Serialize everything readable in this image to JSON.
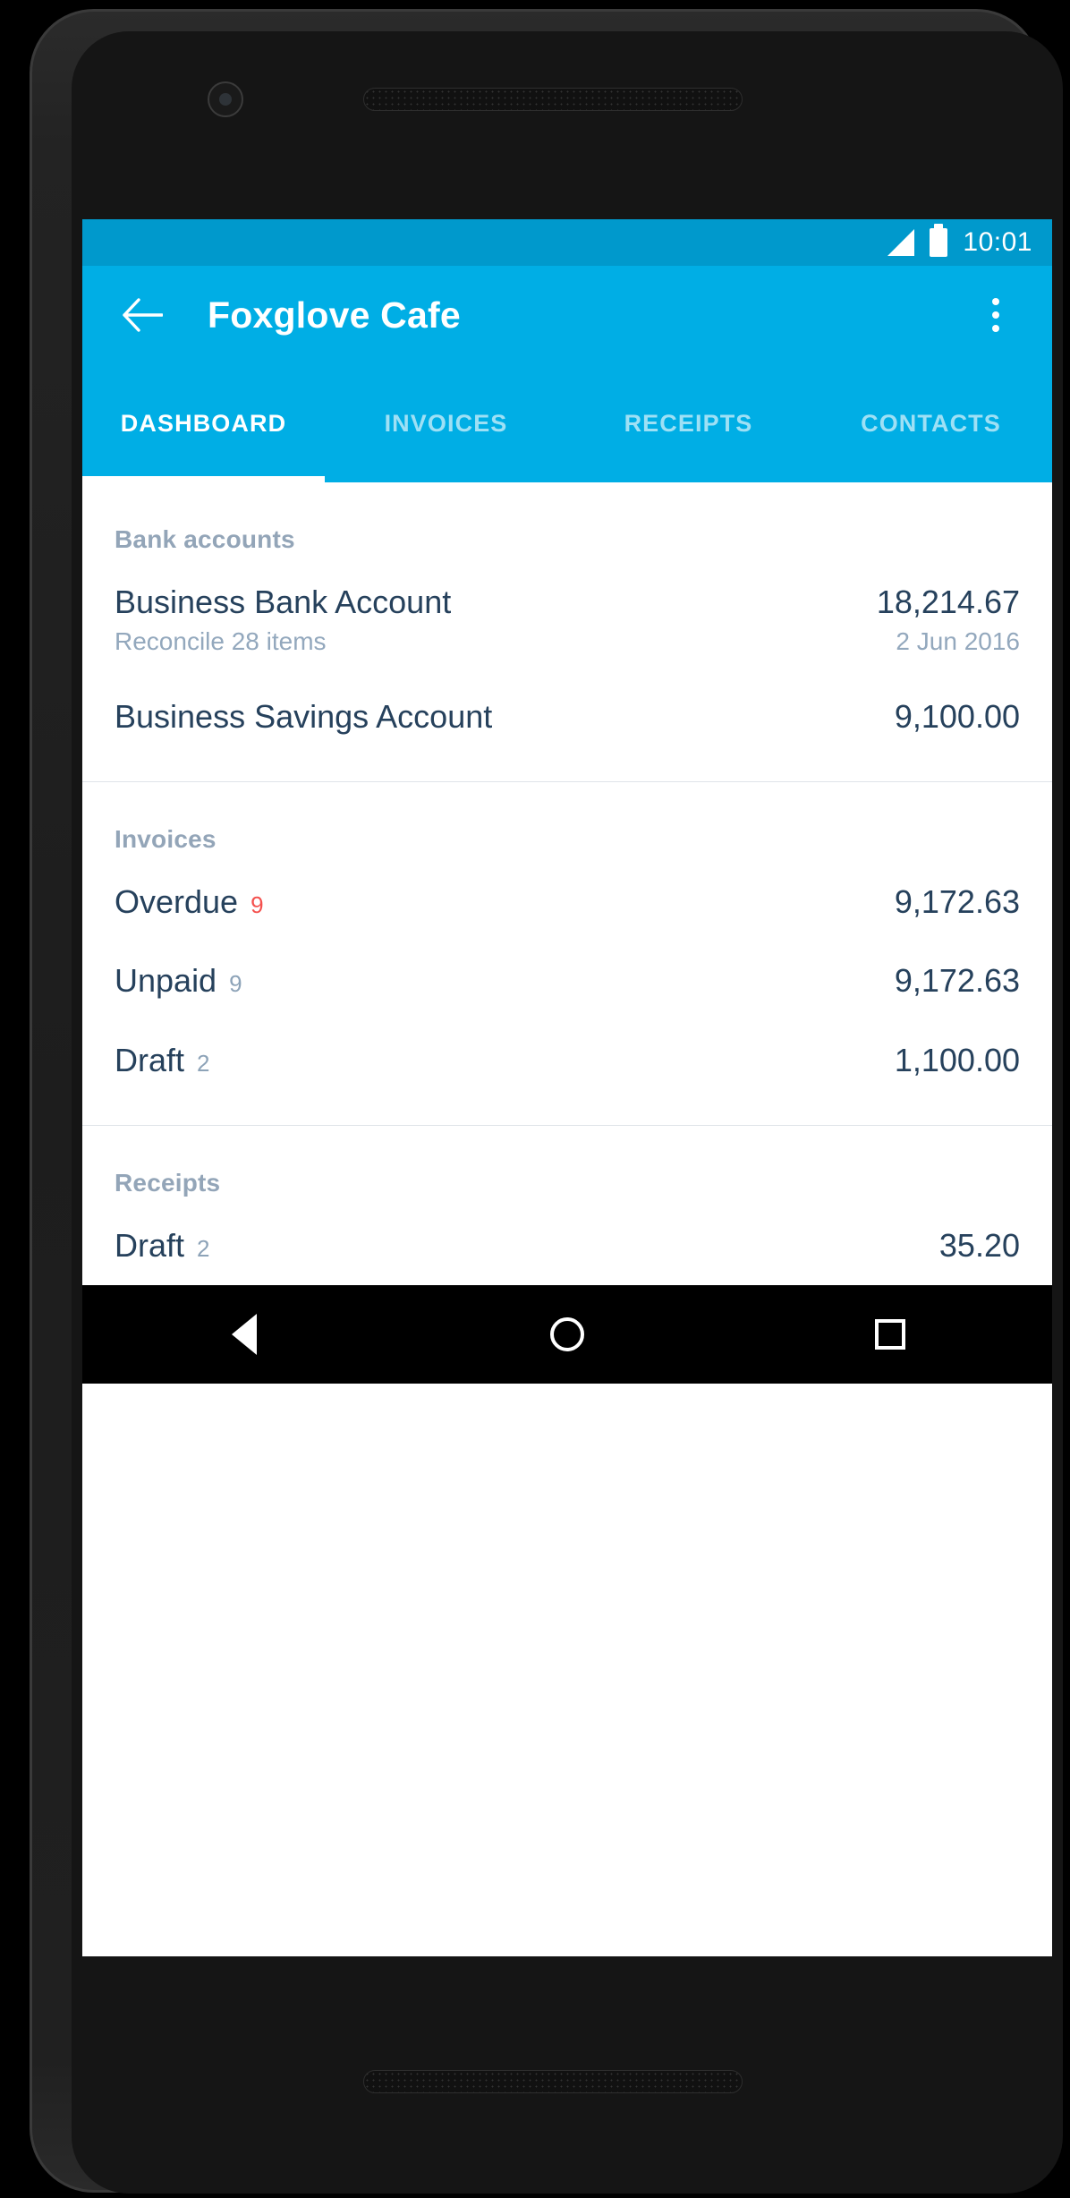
{
  "status_bar": {
    "clock": "10:01",
    "signal_icon": "signal-triangle-icon",
    "battery_icon": "battery-full-icon",
    "background_color": "#0099cc"
  },
  "app_bar": {
    "back_icon": "back-arrow-icon",
    "title": "Foxglove Cafe",
    "overflow_icon": "overflow-menu-icon",
    "background_color": "#00aee5"
  },
  "tabs": [
    {
      "label": "DASHBOARD",
      "active": true
    },
    {
      "label": "INVOICES",
      "active": false
    },
    {
      "label": "RECEIPTS",
      "active": false
    },
    {
      "label": "CONTACTS",
      "active": false
    }
  ],
  "sections": [
    {
      "header": "Bank accounts",
      "rows": [
        {
          "title": "Business Bank Account",
          "subtitle": "Reconcile 28 items",
          "amount": "18,214.67",
          "amount_sub": "2 Jun 2016"
        },
        {
          "title": "Business Savings Account",
          "subtitle": "",
          "amount": "9,100.00",
          "amount_sub": ""
        }
      ]
    },
    {
      "header": "Invoices",
      "rows": [
        {
          "title": "Overdue",
          "count": "9",
          "count_color": "#f4514e",
          "amount": "9,172.63"
        },
        {
          "title": "Unpaid",
          "count": "9",
          "count_color": "#8da3b8",
          "amount": "9,172.63"
        },
        {
          "title": "Draft",
          "count": "2",
          "count_color": "#8da3b8",
          "amount": "1,100.00"
        }
      ]
    },
    {
      "header": "Receipts",
      "rows": [
        {
          "title": "Draft",
          "count": "2",
          "count_color": "#8da3b8",
          "amount": "35.20"
        }
      ]
    }
  ],
  "nav_bar": {
    "back_icon": "nav-back-icon",
    "home_icon": "nav-home-icon",
    "recents_icon": "nav-recents-icon"
  }
}
